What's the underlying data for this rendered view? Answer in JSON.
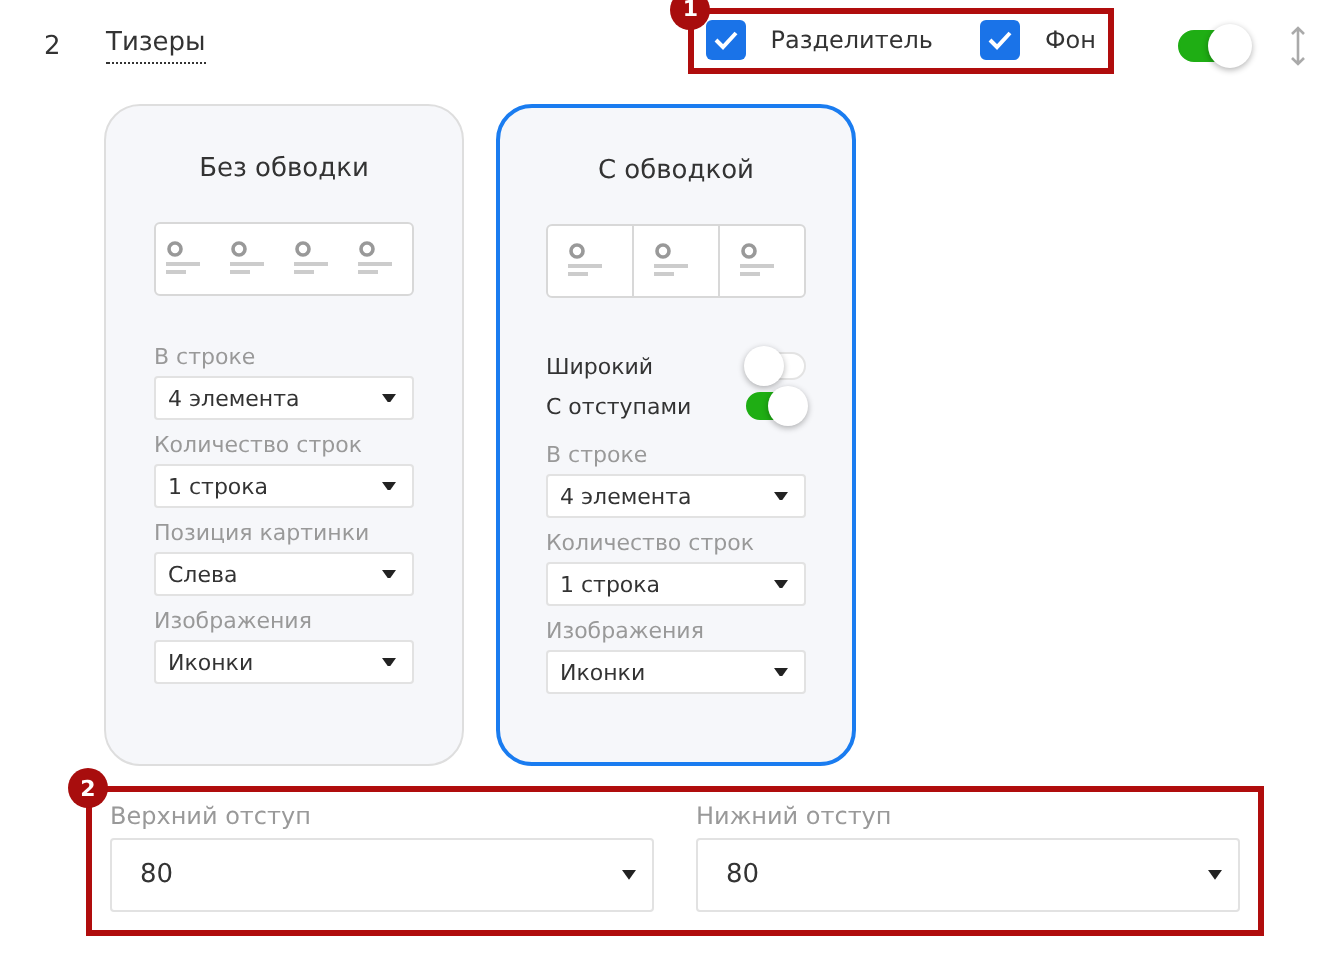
{
  "section": {
    "number": "2",
    "title": "Тизеры",
    "enabled": true
  },
  "header_options": {
    "callout": "1",
    "checkboxes": [
      {
        "label": "Разделитель",
        "checked": true
      },
      {
        "label": "Фон",
        "checked": true
      }
    ]
  },
  "cards": [
    {
      "title": "Без обводки",
      "selected": false,
      "preview": {
        "kind": "plain"
      },
      "settings": [
        {
          "kind": "select",
          "label": "В строке",
          "value": "4 элемента"
        },
        {
          "kind": "select",
          "label": "Количество строк",
          "value": "1 строка"
        },
        {
          "kind": "select",
          "label": "Позиция картинки",
          "value": "Слева"
        },
        {
          "kind": "select",
          "label": "Изображения",
          "value": "Иконки"
        }
      ]
    },
    {
      "title": "С обводкой",
      "selected": true,
      "preview": {
        "kind": "bordered"
      },
      "settings": [
        {
          "kind": "toggle",
          "label": "Широкий",
          "on": false
        },
        {
          "kind": "toggle",
          "label": "С отступами",
          "on": true
        },
        {
          "kind": "select",
          "label": "В строке",
          "value": "4 элемента"
        },
        {
          "kind": "select",
          "label": "Количество строк",
          "value": "1 строка"
        },
        {
          "kind": "select",
          "label": "Изображения",
          "value": "Иконки"
        }
      ]
    }
  ],
  "spacing": {
    "callout": "2",
    "fields": [
      {
        "label": "Верхний отступ",
        "value": "80"
      },
      {
        "label": "Нижний отступ",
        "value": "80"
      }
    ]
  }
}
